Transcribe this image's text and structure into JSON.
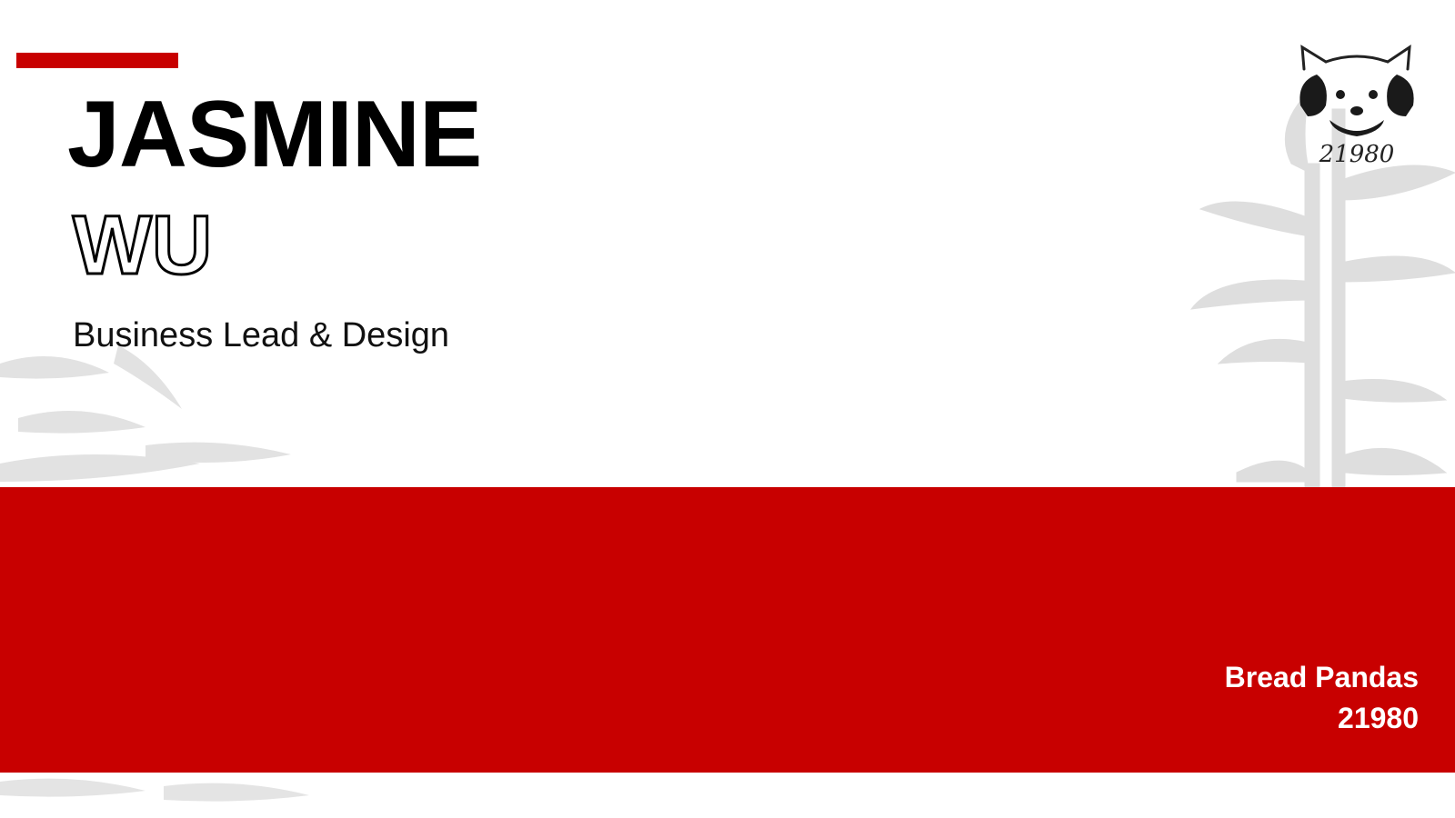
{
  "profile": {
    "first_name": "JASMINE",
    "last_name": "WU",
    "role": "Business Lead & Design"
  },
  "team": {
    "name": "Bread Pandas",
    "number": "21980"
  },
  "logo": {
    "icon": "red-panda-logo-icon",
    "caption": "21980"
  },
  "colors": {
    "accent": "#c80000",
    "background": "#ffffff",
    "text": "#000000",
    "bamboo": "#dcdcdc"
  }
}
